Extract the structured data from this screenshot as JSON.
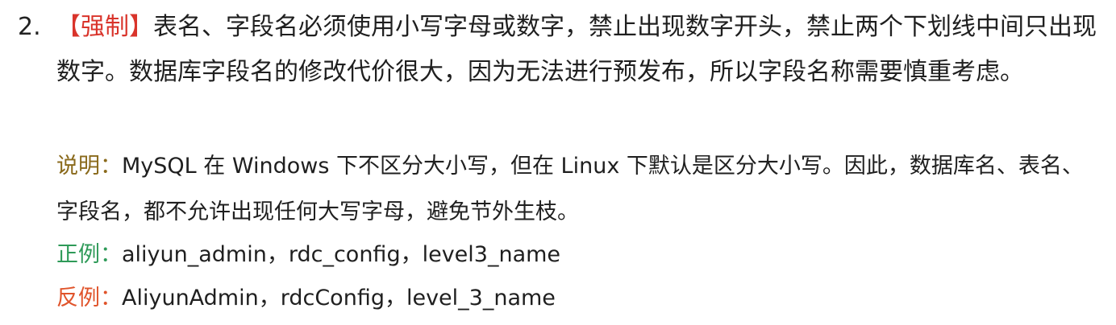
{
  "rule": {
    "number": "2.",
    "tag": "【强制】",
    "text": "表名、字段名必须使用小写字母或数字，禁止出现数字开头，禁止两个下划线中间只出现数字。数据库字段名的修改代价很大，因为无法进行预发布，所以字段名称需要慎重考虑。"
  },
  "note": {
    "label": "说明：",
    "text": "MySQL 在 Windows 下不区分大小写，但在 Linux 下默认是区分大小写。因此，数据库名、表名、字段名，都不允许出现任何大写字母，避免节外生枝。"
  },
  "positive_example": {
    "label": "正例：",
    "text": "aliyun_admin，rdc_config，level3_name"
  },
  "negative_example": {
    "label": "反例：",
    "text": "AliyunAdmin，rdcConfig，level_3_name"
  },
  "colors": {
    "force_tag": "#d9342b",
    "note_label": "#8a6a1c",
    "positive_label": "#2e9a58",
    "negative_label": "#e0542b",
    "body_text": "#1f1f1f"
  }
}
